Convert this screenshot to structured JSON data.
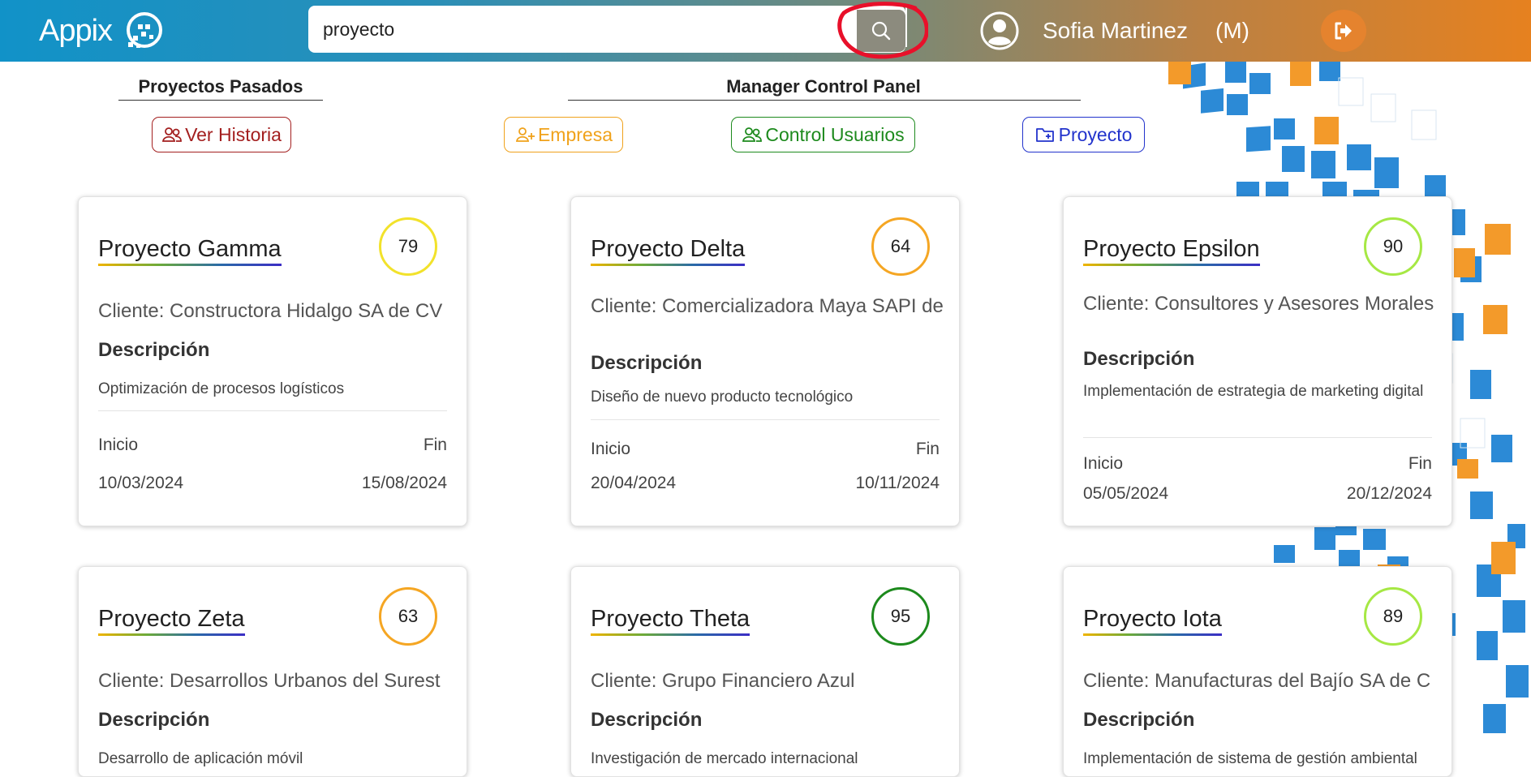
{
  "header": {
    "logo_text": "Appix",
    "search_value": "proyecto",
    "user_name": "Sofia Martinez",
    "user_role": "(M)"
  },
  "sections": {
    "past": {
      "title": "Proyectos Pasados",
      "history_label": "Ver Historia"
    },
    "manager": {
      "title": "Manager Control Panel",
      "empresa_label": "Empresa",
      "users_label": "Control Usuarios",
      "project_label": "Proyecto"
    }
  },
  "colors": {
    "history": "#a31f1f",
    "empresa": "#f0a21b",
    "users": "#1d8a1d",
    "project": "#2233cc"
  },
  "card_labels": {
    "client_prefix": "Cliente: ",
    "description": "Descripción",
    "start": "Inicio",
    "end": "Fin"
  },
  "projects": [
    {
      "name": "Proyecto Gamma",
      "score": "79",
      "score_color": "#f2e22b",
      "client": "Cliente: Constructora Hidalgo SA de CV",
      "description": "Optimización de procesos logísticos",
      "start": "10/03/2024",
      "end": "15/08/2024"
    },
    {
      "name": "Proyecto Delta",
      "score": "64",
      "score_color": "#f5a623",
      "client": "Cliente: Comercializadora Maya SAPI de",
      "description": "Diseño de nuevo producto tecnológico",
      "start": "20/04/2024",
      "end": "10/11/2024"
    },
    {
      "name": "Proyecto Epsilon",
      "score": "90",
      "score_color": "#a6e844",
      "client": "Cliente: Consultores y Asesores Morales",
      "description": "Implementación de estrategia de marketing digital",
      "start": "05/05/2024",
      "end": "20/12/2024"
    },
    {
      "name": "Proyecto Zeta",
      "score": "63",
      "score_color": "#f5a623",
      "client": "Cliente: Desarrollos Urbanos del Surest",
      "description": "Desarrollo de aplicación móvil",
      "start": "",
      "end": ""
    },
    {
      "name": "Proyecto Theta",
      "score": "95",
      "score_color": "#1d8a1d",
      "client": "Cliente: Grupo Financiero Azul",
      "description": "Investigación de mercado internacional",
      "start": "",
      "end": ""
    },
    {
      "name": "Proyecto Iota",
      "score": "89",
      "score_color": "#a6e844",
      "client": "Cliente: Manufacturas del Bajío SA de C",
      "description": "Implementación de sistema de gestión ambiental",
      "start": "",
      "end": ""
    }
  ]
}
